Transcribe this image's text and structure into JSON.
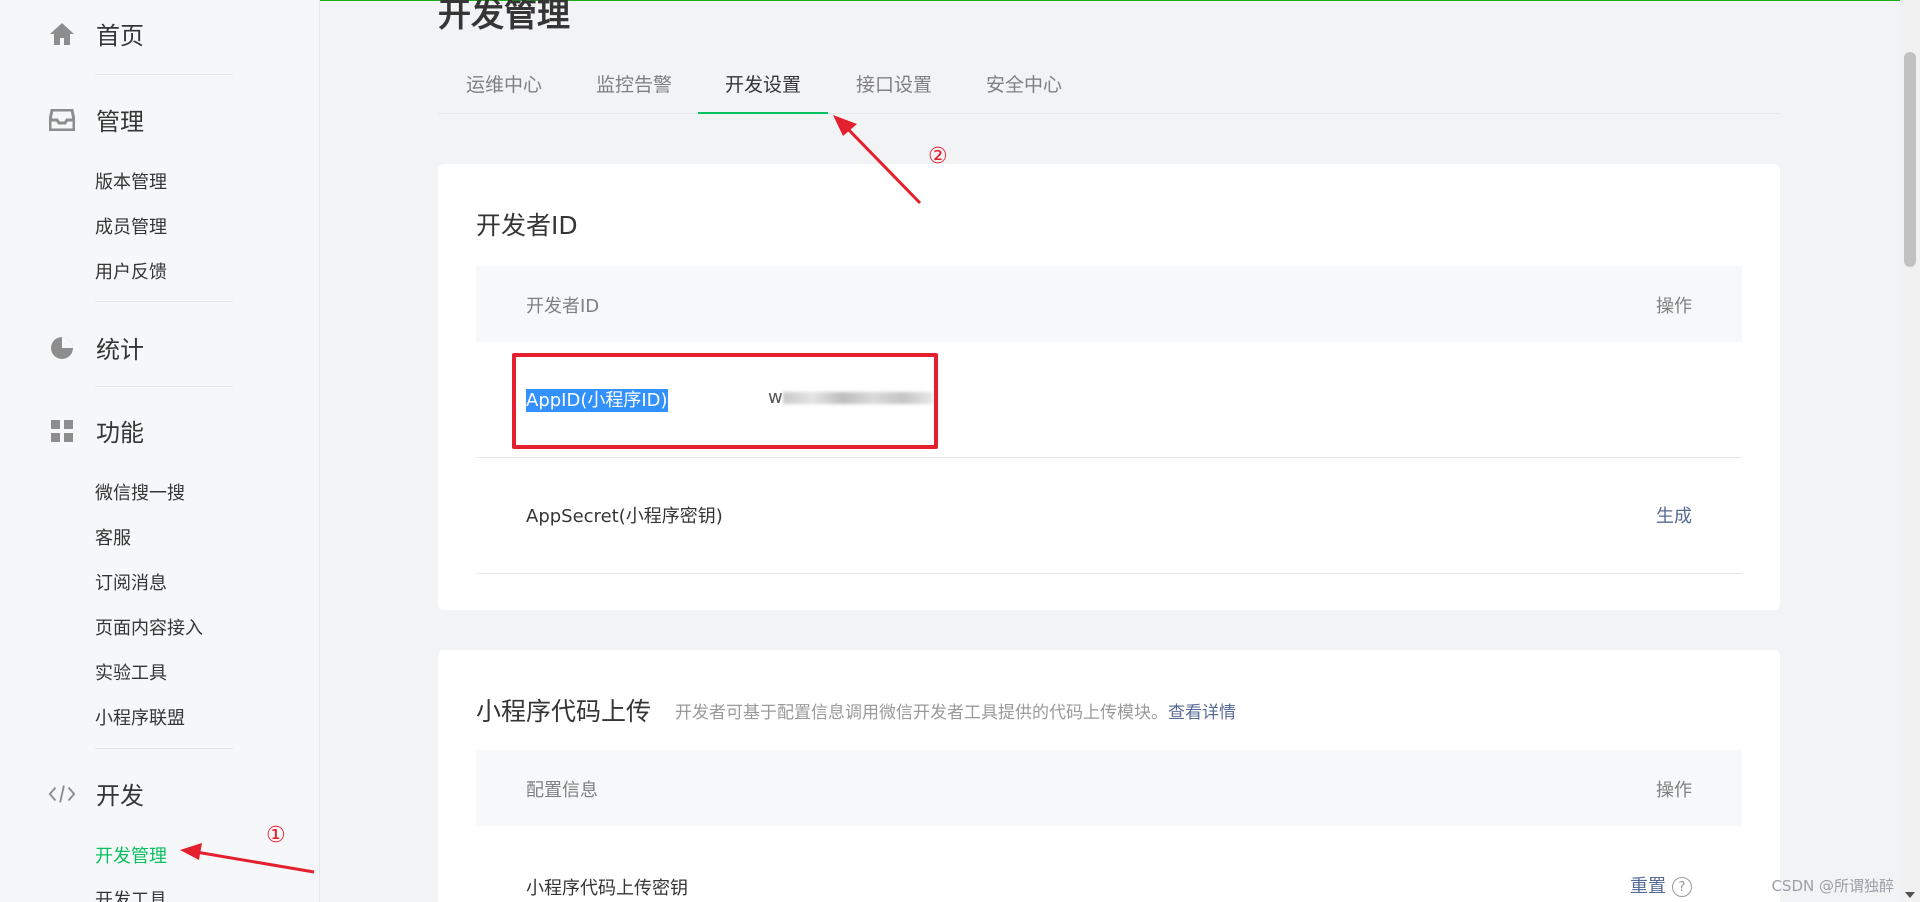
{
  "sidebar": {
    "home": "首页",
    "manage": {
      "label": "管理",
      "items": [
        "版本管理",
        "成员管理",
        "用户反馈"
      ]
    },
    "stats": "统计",
    "features": {
      "label": "功能",
      "items": [
        "微信搜一搜",
        "客服",
        "订阅消息",
        "页面内容接入",
        "实验工具",
        "小程序联盟"
      ]
    },
    "dev": {
      "label": "开发",
      "items": [
        "开发管理",
        "开发工具"
      ]
    }
  },
  "page": {
    "title": "开发管理"
  },
  "tabs": [
    "运维中心",
    "监控告警",
    "开发设置",
    "接口设置",
    "安全中心"
  ],
  "developer_id_card": {
    "title": "开发者ID",
    "header": {
      "left": "开发者ID",
      "right": "操作"
    },
    "appid": {
      "label": "AppID(小程序ID)",
      "value_prefix": "w"
    },
    "appsecret": {
      "label": "AppSecret(小程序密钥)",
      "action": "生成"
    }
  },
  "upload_card": {
    "title": "小程序代码上传",
    "desc": "开发者可基于配置信息调用微信开发者工具提供的代码上传模块。",
    "desc_link": "查看详情",
    "header": {
      "left": "配置信息",
      "right": "操作"
    },
    "row": {
      "label": "小程序代码上传密钥",
      "action": "重置",
      "help": "?"
    }
  },
  "annotations": {
    "one": "①",
    "two": "②"
  },
  "watermark": "CSDN @所谓独醉",
  "colors": {
    "accent": "#07c160",
    "link": "#576b95",
    "annotation": "#e5202e",
    "selection": "#3390ff"
  }
}
